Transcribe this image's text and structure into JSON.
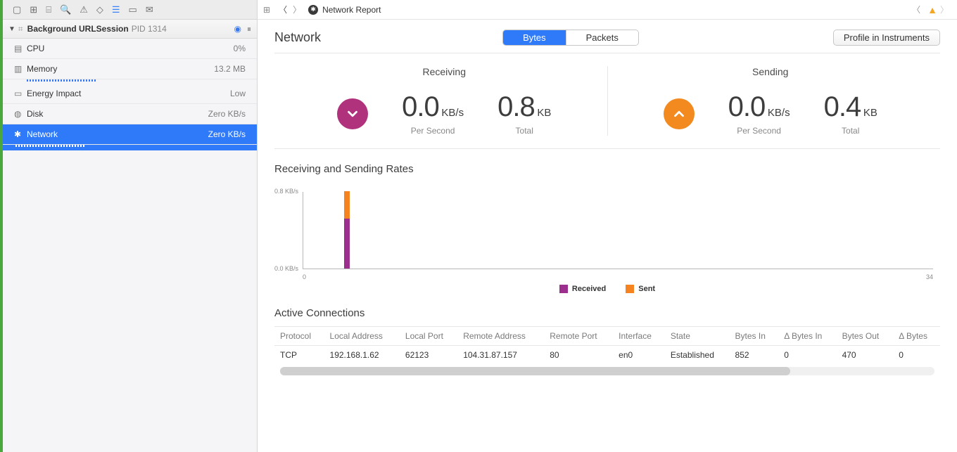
{
  "sidebar": {
    "process_name": "Background URLSession",
    "pid_label": "PID 1314",
    "items": [
      {
        "icon": "cpu-icon",
        "label": "CPU",
        "value": "0%"
      },
      {
        "icon": "memory-icon",
        "label": "Memory",
        "value": "13.2 MB"
      },
      {
        "icon": "energy-icon",
        "label": "Energy Impact",
        "value": "Low"
      },
      {
        "icon": "disk-icon",
        "label": "Disk",
        "value": "Zero KB/s"
      },
      {
        "icon": "network-icon",
        "label": "Network",
        "value": "Zero KB/s"
      }
    ]
  },
  "breadcrumb": {
    "title": "Network Report"
  },
  "header": {
    "title": "Network",
    "tab_bytes": "Bytes",
    "tab_packets": "Packets",
    "profile_button": "Profile in Instruments"
  },
  "stats": {
    "receiving_label": "Receiving",
    "sending_label": "Sending",
    "recv_rate_val": "0.0",
    "recv_rate_unit": "KB/s",
    "recv_rate_label": "Per Second",
    "recv_total_val": "0.8",
    "recv_total_unit": "KB",
    "recv_total_label": "Total",
    "send_rate_val": "0.0",
    "send_rate_unit": "KB/s",
    "send_rate_label": "Per Second",
    "send_total_val": "0.4",
    "send_total_unit": "KB",
    "send_total_label": "Total"
  },
  "chart_section_title": "Receiving and Sending Rates",
  "chart_data": {
    "type": "bar",
    "x": [
      0,
      34
    ],
    "xlabel": "",
    "ylabel": "",
    "y_ticks": [
      "0.0 KB/s",
      "0.8 KB/s"
    ],
    "series": [
      {
        "name": "Received",
        "color": "#9c2f8e",
        "values": {
          "t": 2,
          "kbps": 0.52
        }
      },
      {
        "name": "Sent",
        "color": "#f5831f",
        "values": {
          "t": 2,
          "kbps": 0.28
        }
      }
    ],
    "legend": [
      "Received",
      "Sent"
    ],
    "xlim": [
      0,
      34
    ],
    "ylim": [
      0.0,
      0.8
    ]
  },
  "connections": {
    "title": "Active Connections",
    "columns": [
      "Protocol",
      "Local Address",
      "Local Port",
      "Remote Address",
      "Remote Port",
      "Interface",
      "State",
      "Bytes In",
      "Δ Bytes In",
      "Bytes Out",
      "Δ Bytes"
    ],
    "rows": [
      [
        "TCP",
        "192.168.1.62",
        "62123",
        "104.31.87.157",
        "80",
        "en0",
        "Established",
        "852",
        "0",
        "470",
        "0"
      ]
    ]
  },
  "colors": {
    "received": "#9c2f8e",
    "sent": "#f5831f",
    "select": "#2f7af9"
  }
}
